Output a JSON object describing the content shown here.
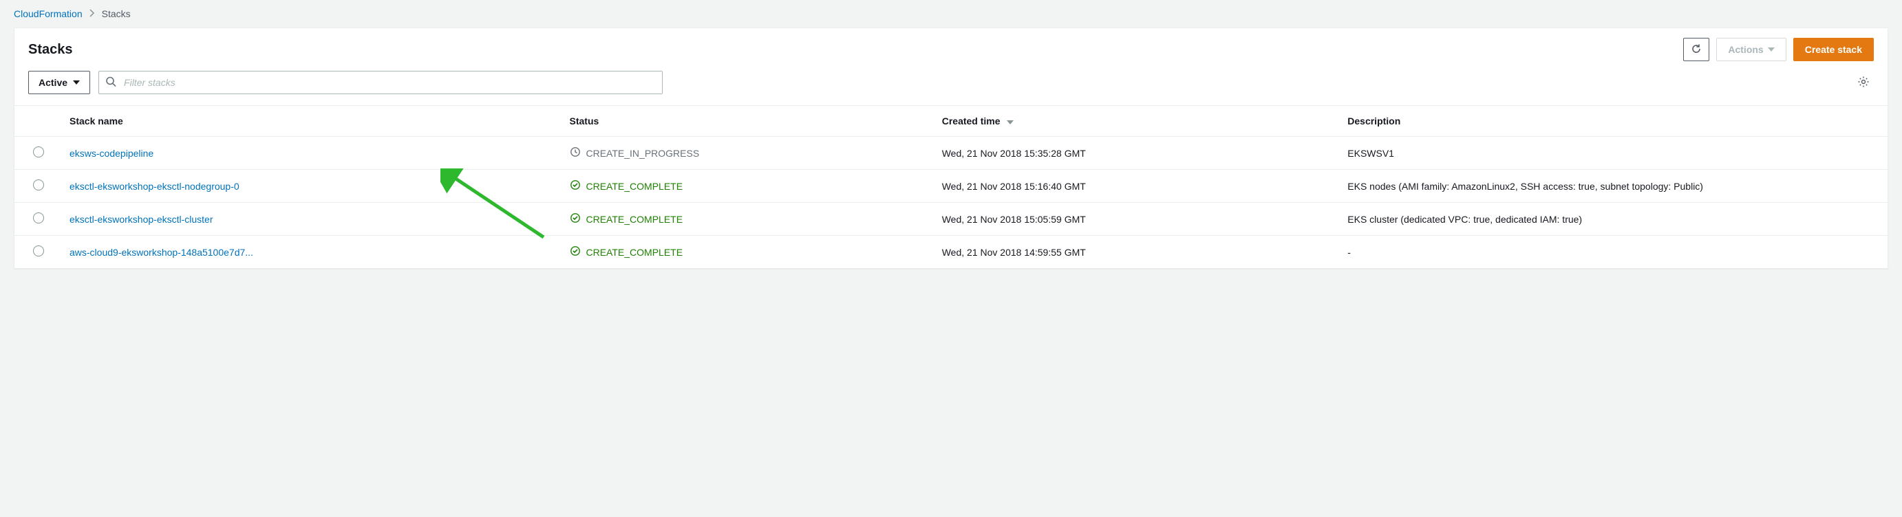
{
  "breadcrumb": {
    "root": "CloudFormation",
    "current": "Stacks"
  },
  "header": {
    "title": "Stacks",
    "actions_label": "Actions",
    "create_label": "Create stack"
  },
  "toolbar": {
    "filter_status": "Active",
    "search_placeholder": "Filter stacks"
  },
  "columns": {
    "name": "Stack name",
    "status": "Status",
    "created": "Created time",
    "description": "Description"
  },
  "statuses": {
    "in_progress": "CREATE_IN_PROGRESS",
    "complete": "CREATE_COMPLETE"
  },
  "rows": [
    {
      "name": "eksws-codepipeline",
      "status_key": "in_progress",
      "created": "Wed, 21 Nov 2018 15:35:28 GMT",
      "description": "EKSWSV1"
    },
    {
      "name": "eksctl-eksworkshop-eksctl-nodegroup-0",
      "status_key": "complete",
      "created": "Wed, 21 Nov 2018 15:16:40 GMT",
      "description": "EKS nodes (AMI family: AmazonLinux2, SSH access: true, subnet topology: Public)"
    },
    {
      "name": "eksctl-eksworkshop-eksctl-cluster",
      "status_key": "complete",
      "created": "Wed, 21 Nov 2018 15:05:59 GMT",
      "description": "EKS cluster (dedicated VPC: true, dedicated IAM: true)"
    },
    {
      "name": "aws-cloud9-eksworkshop-148a5100e7d7...",
      "status_key": "complete",
      "created": "Wed, 21 Nov 2018 14:59:55 GMT",
      "description": "-"
    }
  ]
}
